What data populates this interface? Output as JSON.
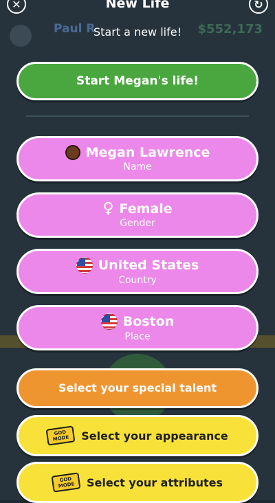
{
  "modal": {
    "title": "New Life",
    "subtitle": "Start a new life!",
    "close_glyph": "✕",
    "refresh_glyph": "↻"
  },
  "start_button": {
    "label": "Start Megan's life!"
  },
  "identity": {
    "name": {
      "value": "Megan Lawrence",
      "label": "Name",
      "icon": "avatar-face-icon"
    },
    "gender": {
      "value": "Female",
      "label": "Gender",
      "icon": "female-symbol-icon",
      "glyph": "♀"
    },
    "country": {
      "value": "United States",
      "label": "Country",
      "icon": "us-flag-icon"
    },
    "place": {
      "value": "Boston",
      "label": "Place",
      "icon": "us-flag-icon"
    }
  },
  "talent_button": {
    "label": "Select your special talent"
  },
  "appearance_button": {
    "label": "Select your appearance",
    "badge_top": "GOD",
    "badge_bottom": "MODE"
  },
  "attributes_button": {
    "label": "Select your attributes",
    "badge_top": "GOD",
    "badge_bottom": "MODE"
  },
  "background": {
    "character_name": "Paul R",
    "money": "$552,173"
  },
  "colors": {
    "start_green": "#4aa73f",
    "option_pink": "#ec88ea",
    "talent_orange": "#ef9530",
    "godmode_yellow": "#f8e23a"
  }
}
